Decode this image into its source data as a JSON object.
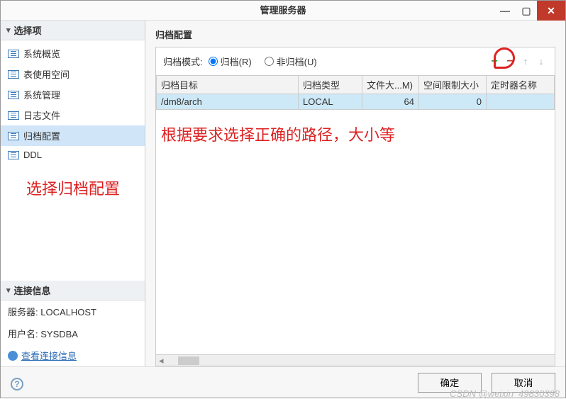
{
  "window": {
    "title": "管理服务器"
  },
  "sidebar": {
    "options_header": "选择项",
    "items": [
      {
        "label": "系统概览"
      },
      {
        "label": "表使用空间"
      },
      {
        "label": "系统管理"
      },
      {
        "label": "日志文件"
      },
      {
        "label": "归档配置"
      },
      {
        "label": "DDL"
      }
    ],
    "conn_header": "连接信息",
    "server_label": "服务器: LOCALHOST",
    "user_label": "用户名: SYSDBA",
    "view_conn_link": "查看连接信息"
  },
  "main": {
    "title": "归档配置",
    "mode_label": "归档模式:",
    "radio_archive": "归档(R)",
    "radio_nonarchive": "非归档(U)",
    "table": {
      "headers": [
        "归档目标",
        "归档类型",
        "文件大...M)",
        "空间限制大小",
        "定时器名称"
      ],
      "rows": [
        {
          "target": "/dm8/arch",
          "type": "LOCAL",
          "file_size": "64",
          "space_limit": "0",
          "timer": ""
        }
      ]
    }
  },
  "annotations": {
    "a1": "根据要求选择正确的路径，大小等",
    "a2": "选择归档配置"
  },
  "buttons": {
    "ok": "确定",
    "cancel": "取消"
  },
  "watermark": "CSDN @weixin_49830398"
}
